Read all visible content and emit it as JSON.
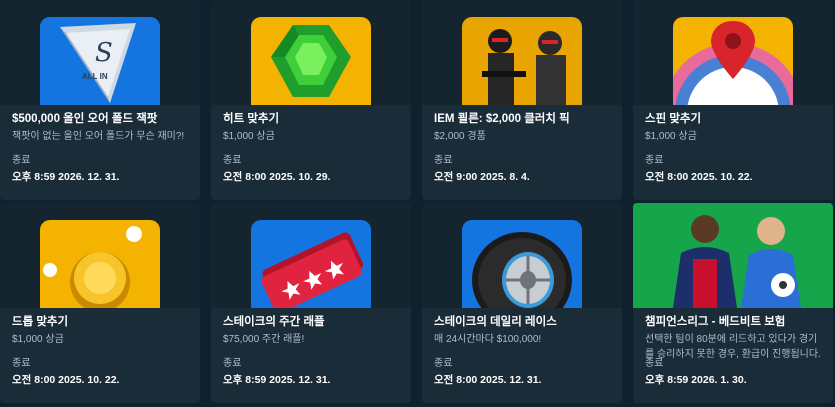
{
  "promotions": [
    {
      "title": "$500,000 올인 오어 폴드 잭팟",
      "subtitle": "잭팟이 없는 올인 오어 폴드가 무슨 재미?!",
      "status_label": "종료",
      "end_time": "오후 8:59 2026. 12. 31.",
      "icon": "all-in-chip-icon"
    },
    {
      "title": "히트 맞추기",
      "subtitle": "$1,000 상금",
      "status_label": "종료",
      "end_time": "오전 8:00 2025. 10. 29.",
      "icon": "emerald-gem-icon"
    },
    {
      "title": "IEM 쾰른: $2,000 클러치 픽",
      "subtitle": "$2,000 경품",
      "status_label": "종료",
      "end_time": "오전 9:00 2025. 8. 4.",
      "icon": "esports-soldiers-icon"
    },
    {
      "title": "스핀 맞추기",
      "subtitle": "$1,000 상금",
      "status_label": "종료",
      "end_time": "오전 8:00 2025. 10. 22.",
      "icon": "map-pin-wheel-icon"
    },
    {
      "title": "드롭 맞추기",
      "subtitle": "$1,000 상금",
      "status_label": "종료",
      "end_time": "오전 8:00 2025. 10. 22.",
      "icon": "plinko-ball-icon"
    },
    {
      "title": "스테이크의 주간 래플",
      "subtitle": "$75,000 주간 래플!",
      "status_label": "종료",
      "end_time": "오후 8:59 2025. 12. 31.",
      "icon": "raffle-ticket-icon"
    },
    {
      "title": "스테이크의 데일리 레이스",
      "subtitle": "매 24시간마다 $100,000!",
      "status_label": "종료",
      "end_time": "오전 8:00 2025. 12. 31.",
      "icon": "racing-tire-icon"
    },
    {
      "title": "챔피언스리그 - 베드비트 보험",
      "subtitle": "선택한 팀이 80분에 리드하고 있다가 경기를 승리하지 못한 경우, 환급이 진행됩니다.",
      "status_label": "종료",
      "end_time": "오후 8:59 2026. 1. 30.",
      "icon": "football-players-icon"
    }
  ],
  "thumb_text": {
    "all_in": "ALL IN",
    "s_logo": "S"
  },
  "colors": {
    "page_bg": "#0f212e",
    "card_bg": "#1a2c38",
    "text_muted": "#b1bad3",
    "accent_blue": "#1475e1",
    "accent_yellow": "#f5b301"
  }
}
